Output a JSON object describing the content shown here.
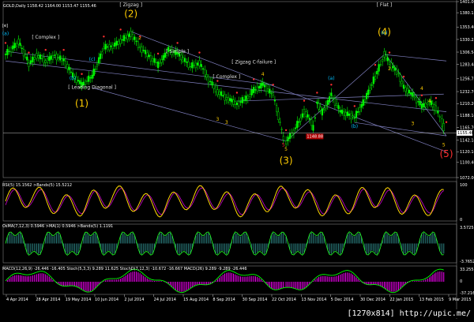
{
  "header": {
    "symbol_line": "GOLD,Daily  1158.42 1164.00 1153.47 1155.46",
    "marker": "[e]"
  },
  "indicators": {
    "rsi_label": "RSI(5) 15.1562  >Bands(5) 15.5212",
    "osma_label": "OsMA(7,12,3) 0.5946  >MA(1) 0.5946  >Bands(5) 1.1191",
    "macd_label": "MACD(12,26,9) -26.446 -16.405  Stoch(5,3,3) 9.289 11.625  StochD(7,12,3) -10.672 -16.667  MACD(26) 9.289 -9.289 -26.446"
  },
  "watermark": "[1270x814] http://upic.me/",
  "colors": {
    "background": "#000000",
    "bull_candle": "#00ff00",
    "bear_candle": "#000000",
    "wave_label": "#ffcc00",
    "count_red": "#ff3030",
    "count_cyan": "#00c0ff",
    "trendline": "#8080c0",
    "rsi_line": "#ffd700",
    "osma_bars": "#20ff20",
    "macd_hist": "#ff00ff",
    "macd_main": "#00ff00"
  },
  "chart_data": {
    "type": "candlestick",
    "title": "GOLD,Daily",
    "last_price": 1155.46,
    "annotated_price": 1148.88,
    "price_axis": {
      "ticks": [
        1401.0,
        1380.15,
        1353.4,
        1330.25,
        1306.54,
        1283.44,
        1256.75,
        1232.74,
        1210.2,
        1188.14,
        1165.7,
        1142.14,
        1120.14,
        1100.4,
        1072.0
      ]
    },
    "date_axis": {
      "ticks": [
        "4 Apr 2014",
        "28 Apr 2014",
        "19 May 2014",
        "10 Jun 2014",
        "2 Jul 2014",
        "24 Jul 2014",
        "15 Aug 2014",
        "8 Sep 2014",
        "30 Sep 2014",
        "22 Oct 2014",
        "13 Nov 2014",
        "5 Dec 2014",
        "30 Dec 2014",
        "22 Jan 2015",
        "13 Feb 2015",
        "9 Mar 2015"
      ]
    },
    "panels": [
      {
        "name": "RSI",
        "ticks": [
          100.0,
          0.0
        ]
      },
      {
        "name": "OsMA",
        "ticks": [
          3.5725,
          -3.7652
        ]
      },
      {
        "name": "MACD",
        "ticks": [
          33.255,
          0.0,
          -37.2165
        ]
      }
    ],
    "close_path": [
      {
        "date": "2014-04-04",
        "close": 1303
      },
      {
        "date": "2014-04-14",
        "close": 1325
      },
      {
        "date": "2014-04-22",
        "close": 1285
      },
      {
        "date": "2014-04-28",
        "close": 1300
      },
      {
        "date": "2014-05-05",
        "close": 1290
      },
      {
        "date": "2014-05-12",
        "close": 1300
      },
      {
        "date": "2014-05-19",
        "close": 1290
      },
      {
        "date": "2014-05-26",
        "close": 1262
      },
      {
        "date": "2014-06-02",
        "close": 1245
      },
      {
        "date": "2014-06-10",
        "close": 1262
      },
      {
        "date": "2014-06-19",
        "close": 1315
      },
      {
        "date": "2014-06-26",
        "close": 1318
      },
      {
        "date": "2014-07-02",
        "close": 1328
      },
      {
        "date": "2014-07-10",
        "close": 1340
      },
      {
        "date": "2014-07-17",
        "close": 1315
      },
      {
        "date": "2014-07-24",
        "close": 1298
      },
      {
        "date": "2014-07-31",
        "close": 1283
      },
      {
        "date": "2014-08-08",
        "close": 1310
      },
      {
        "date": "2014-08-15",
        "close": 1303
      },
      {
        "date": "2014-08-25",
        "close": 1280
      },
      {
        "date": "2014-09-01",
        "close": 1285
      },
      {
        "date": "2014-09-08",
        "close": 1255
      },
      {
        "date": "2014-09-15",
        "close": 1232
      },
      {
        "date": "2014-09-22",
        "close": 1220
      },
      {
        "date": "2014-09-30",
        "close": 1210
      },
      {
        "date": "2014-10-07",
        "close": 1220
      },
      {
        "date": "2014-10-13",
        "close": 1235
      },
      {
        "date": "2014-10-20",
        "close": 1245
      },
      {
        "date": "2014-10-28",
        "close": 1225
      },
      {
        "date": "2014-11-05",
        "close": 1145
      },
      {
        "date": "2014-11-07",
        "close": 1140
      },
      {
        "date": "2014-11-13",
        "close": 1160
      },
      {
        "date": "2014-11-21",
        "close": 1195
      },
      {
        "date": "2014-11-28",
        "close": 1170
      },
      {
        "date": "2014-12-01",
        "close": 1210
      },
      {
        "date": "2014-12-05",
        "close": 1195
      },
      {
        "date": "2014-12-12",
        "close": 1225
      },
      {
        "date": "2014-12-19",
        "close": 1195
      },
      {
        "date": "2014-12-30",
        "close": 1185
      },
      {
        "date": "2015-01-07",
        "close": 1218
      },
      {
        "date": "2015-01-15",
        "close": 1262
      },
      {
        "date": "2015-01-22",
        "close": 1302
      },
      {
        "date": "2015-01-26",
        "close": 1285
      },
      {
        "date": "2015-02-02",
        "close": 1265
      },
      {
        "date": "2015-02-06",
        "close": 1240
      },
      {
        "date": "2015-02-13",
        "close": 1225
      },
      {
        "date": "2015-02-20",
        "close": 1205
      },
      {
        "date": "2015-02-26",
        "close": 1213
      },
      {
        "date": "2015-03-03",
        "close": 1200
      },
      {
        "date": "2015-03-09",
        "close": 1165
      },
      {
        "date": "2015-03-11",
        "close": 1155
      }
    ],
    "annotations": {
      "wave_labels": [
        "(1)",
        "(2)",
        "(3)",
        "(4)",
        "(5)",
        "(1)"
      ],
      "text_labels": [
        "[ Zigzag ]",
        "[ Complex ]",
        "[ Simple ]",
        "[ Leading Diagonal ]",
        "[ Zigzag C-failure ]",
        "[ Flat ]",
        "[ Complex ]"
      ],
      "minor_counts": [
        "(a)",
        "(b)",
        "(c)",
        "(a)",
        "(b)",
        "(c)",
        "2",
        "3",
        "4",
        "5",
        "4",
        "2",
        "4",
        "3",
        "3",
        "5",
        "5"
      ]
    }
  }
}
